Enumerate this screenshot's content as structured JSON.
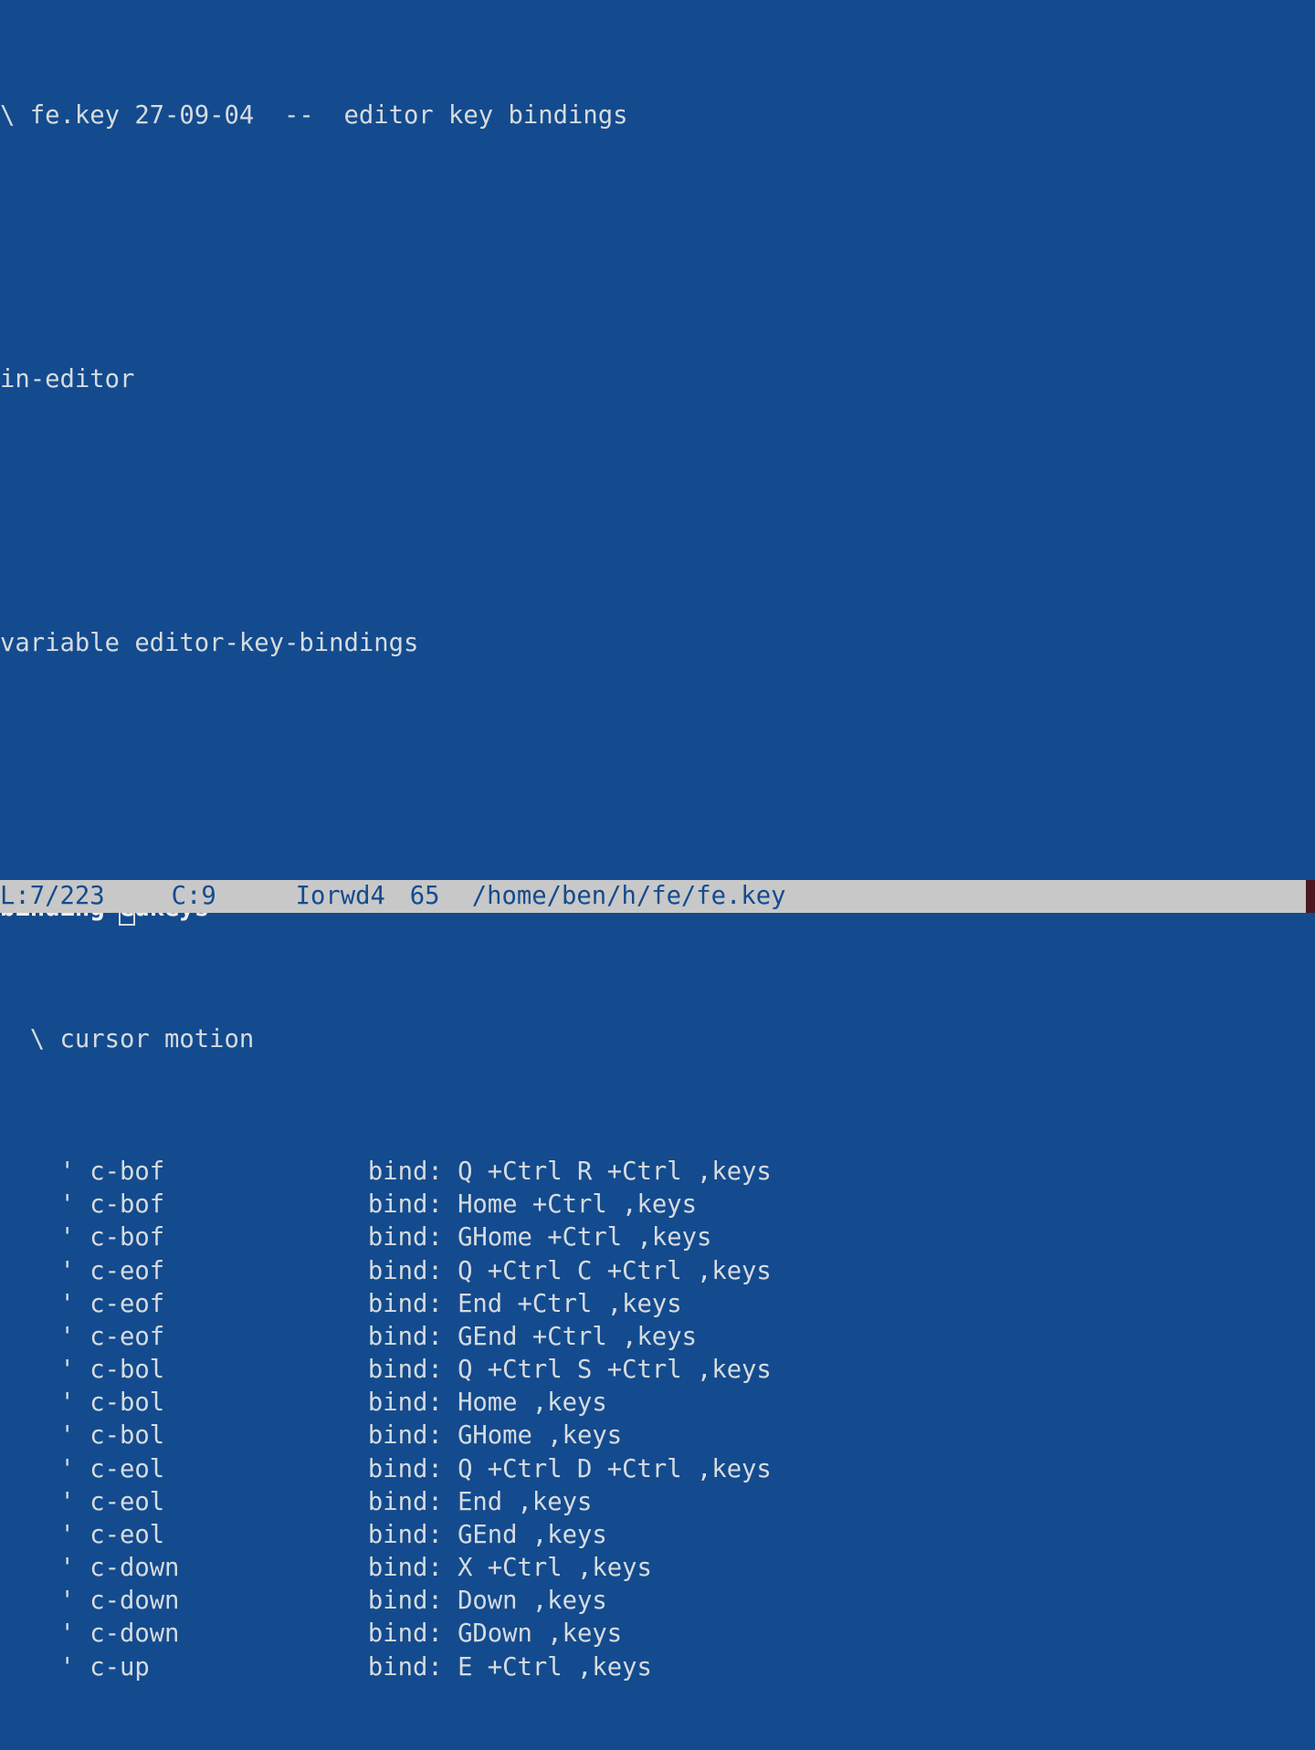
{
  "header": {
    "comment_line": "\\ fe.key 27-09-04  --  editor key bindings"
  },
  "mode_line": "in-editor",
  "var_line": "variable editor-key-bindings",
  "binding_header": {
    "prefix": "binding ",
    "cursor": "e",
    "suffix": "dkeys"
  },
  "section_comment": "  \\ cursor motion",
  "bindings": [
    {
      "cmd": "c-bof",
      "keys": "Q +Ctrl R +Ctrl ,keys"
    },
    {
      "cmd": "c-bof",
      "keys": "Home +Ctrl ,keys"
    },
    {
      "cmd": "c-bof",
      "keys": "GHome +Ctrl ,keys"
    },
    {
      "cmd": "c-eof",
      "keys": "Q +Ctrl C +Ctrl ,keys"
    },
    {
      "cmd": "c-eof",
      "keys": "End +Ctrl ,keys"
    },
    {
      "cmd": "c-eof",
      "keys": "GEnd +Ctrl ,keys"
    },
    {
      "cmd": "c-bol",
      "keys": "Q +Ctrl S +Ctrl ,keys"
    },
    {
      "cmd": "c-bol",
      "keys": "Home ,keys"
    },
    {
      "cmd": "c-bol",
      "keys": "GHome ,keys"
    },
    {
      "cmd": "c-eol",
      "keys": "Q +Ctrl D +Ctrl ,keys"
    },
    {
      "cmd": "c-eol",
      "keys": "End ,keys"
    },
    {
      "cmd": "c-eol",
      "keys": "GEnd ,keys"
    },
    {
      "cmd": "c-down",
      "keys": "X +Ctrl ,keys"
    },
    {
      "cmd": "c-down",
      "keys": "Down ,keys"
    },
    {
      "cmd": "c-down",
      "keys": "GDown ,keys"
    },
    {
      "cmd": "c-up",
      "keys": "E +Ctrl ,keys"
    }
  ],
  "row_indent": "    ' ",
  "bind_prefix": "bind: ",
  "status": {
    "line_pos": "L:7/223",
    "col_pos": "C:9",
    "mode": "Iorwd4",
    "extra": "65",
    "path": "/home/ben/h/fe/fe.key"
  }
}
